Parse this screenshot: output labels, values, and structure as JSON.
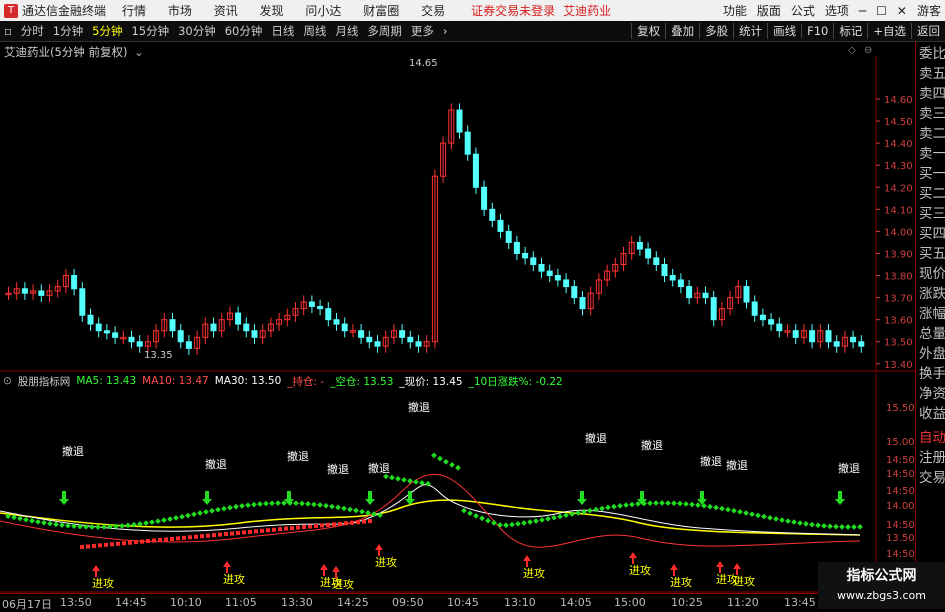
{
  "titlebar": {
    "app_name": "通达信金融终端",
    "menus": [
      "行情",
      "市场",
      "资讯",
      "发现",
      "问小达",
      "财富圈",
      "交易"
    ],
    "warning": "证券交易未登录",
    "stock_name": "艾迪药业",
    "right_items": [
      "功能",
      "版面",
      "公式",
      "选项",
      "游客"
    ]
  },
  "toolbar": {
    "periods": [
      "分时",
      "1分钟",
      "5分钟",
      "15分钟",
      "30分钟",
      "60分钟",
      "日线",
      "周线",
      "月线",
      "多周期",
      "更多"
    ],
    "active_index": 2,
    "right_buttons": [
      "复权",
      "叠加",
      "多股",
      "统计",
      "画线",
      "F10",
      "标记",
      "+自选",
      "返回"
    ]
  },
  "main_chart": {
    "title": "艾迪药业(5分钟 前复权)",
    "high_label": "14.65",
    "low_label": "13.35",
    "axis_labels": [
      "14.60",
      "14.50",
      "14.40",
      "14.30",
      "14.20",
      "14.10",
      "14.00",
      "13.90",
      "13.80",
      "13.70",
      "13.60",
      "13.50",
      "13.40"
    ]
  },
  "sub_chart": {
    "title": "股朋指标网",
    "ma5": "MA5: 13.43",
    "ma10": "MA10: 13.47",
    "ma30": "MA30: 13.50",
    "hold": "_持仓: -",
    "empty": "_空仓: 13.53",
    "price": "_现价: 13.45",
    "change": "_10日涨跌%: -0.22",
    "axis_labels": [
      "15.50",
      "15.00",
      "14:50",
      "14:50",
      "14:50",
      "14.00",
      "14:50",
      "13.50",
      "14:50"
    ],
    "retreat_label": "撤退",
    "attack_label": "进攻"
  },
  "right_panel": [
    "委比",
    "卖五",
    "卖四",
    "卖三",
    "卖二",
    "卖一",
    "买一",
    "买二",
    "买三",
    "买四",
    "买五",
    "现价",
    "涨跌",
    "涨幅",
    "总量",
    "外盘",
    "换手",
    "净资",
    "收益",
    "自动",
    "注册",
    "交易"
  ],
  "bottom_bar": {
    "date": "06月17日",
    "times": [
      "13:50",
      "14:45",
      "10:10",
      "11:05",
      "13:30",
      "14:25",
      "09:50",
      "10:45",
      "13:10",
      "14:05",
      "15:00",
      "10:25",
      "11:20",
      "13:45"
    ]
  },
  "watermark": {
    "line1": "指标公式网",
    "line2": "www.zbgs3.com"
  },
  "colors": {
    "up": "#ff3232",
    "down": "#54ffff",
    "ma5": "#ffffff",
    "ma10": "#ffff00",
    "ma30": "#ff00ff",
    "frame": "#8b0000"
  }
}
